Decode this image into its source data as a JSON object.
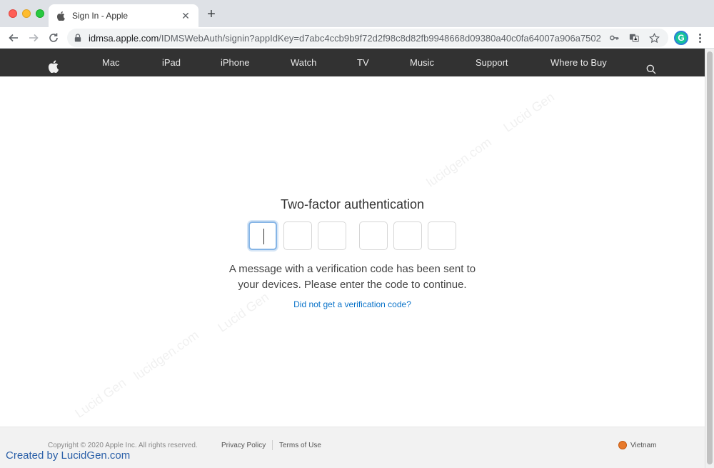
{
  "browser": {
    "tab_title": "Sign In - Apple",
    "close_glyph": "✕",
    "new_tab_glyph": "+",
    "url_host": "idmsa.apple.com",
    "url_path": "/IDMSWebAuth/signin?appIdKey=d7abc4ccb9b9f72d2f98c8d82fb9948668d09380a40c0fa64007a906a7502b...",
    "extension_label": "G"
  },
  "nav": {
    "items": [
      "Mac",
      "iPad",
      "iPhone",
      "Watch",
      "TV",
      "Music",
      "Support",
      "Where to Buy"
    ]
  },
  "main": {
    "heading": "Two-factor authentication",
    "code_length": 6,
    "message_line1": "A message with a verification code has been sent to",
    "message_line2": "your devices. Please enter the code to continue.",
    "resend_link": "Did not get a verification code?"
  },
  "watermark": {
    "texts": [
      "Lucid Gen",
      "lucidgen.com"
    ]
  },
  "footer": {
    "copyright": "Copyright © 2020 Apple Inc. All rights reserved.",
    "privacy": "Privacy Policy",
    "terms": "Terms of Use",
    "region": "Vietnam"
  },
  "credit": "Created by LucidGen.com",
  "colors": {
    "nav_bg": "#323232",
    "link": "#0a73c9",
    "focus": "#86b5e6"
  }
}
